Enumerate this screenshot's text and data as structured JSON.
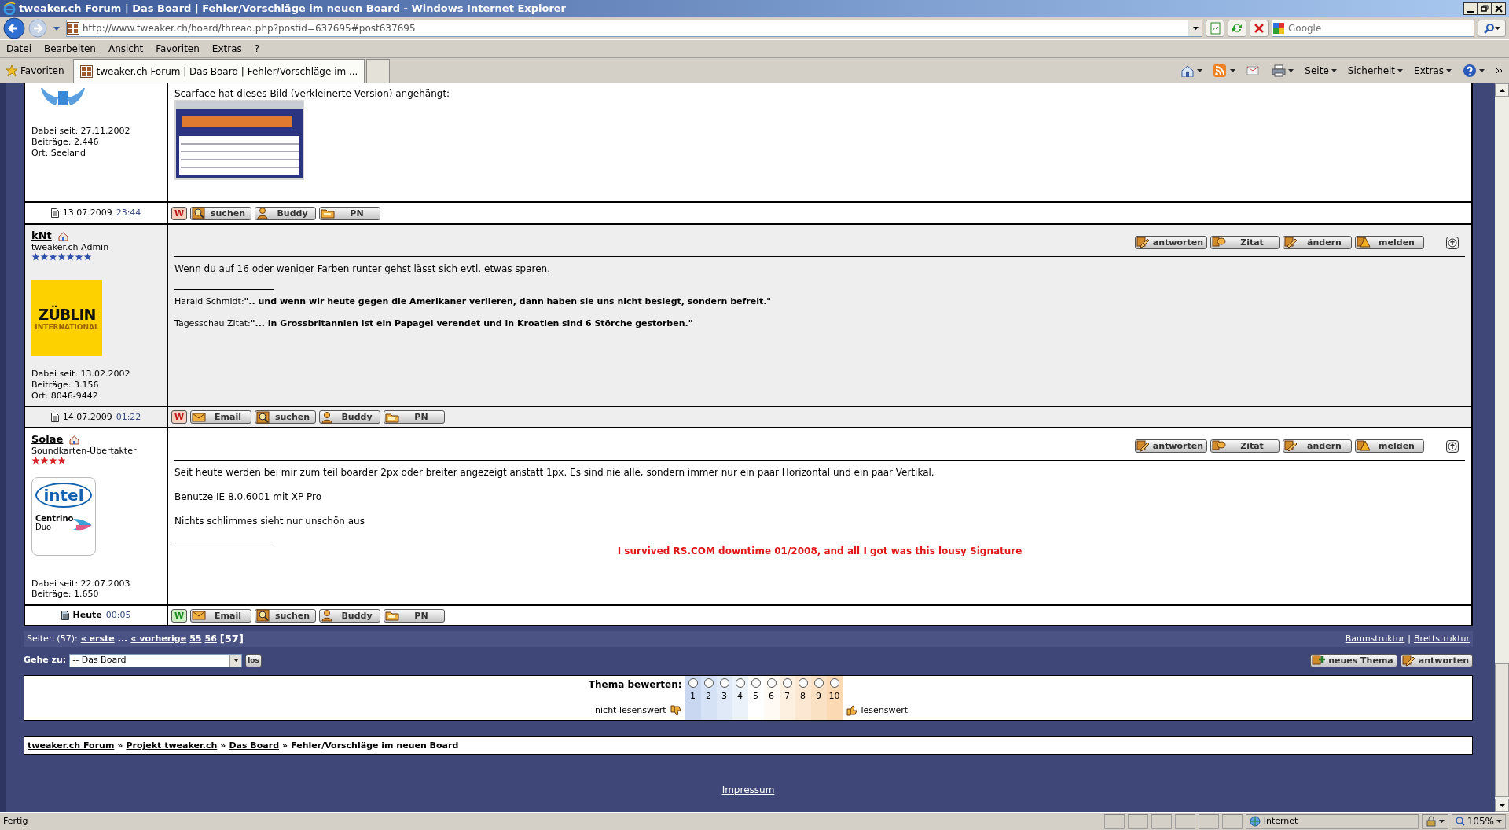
{
  "window": {
    "title": "tweaker.ch Forum | Das Board | Fehler/Vorschläge im neuen Board - Windows Internet Explorer"
  },
  "address_bar": {
    "url": "http://www.tweaker.ch/board/thread.php?postid=637695#post637695"
  },
  "search": {
    "placeholder": "Google"
  },
  "menu": [
    "Datei",
    "Bearbeiten",
    "Ansicht",
    "Favoriten",
    "Extras",
    "?"
  ],
  "favorites_bar": {
    "label": "Favoriten",
    "tabs": [
      {
        "label": "tweaker.ch Forum | Das Board | Fehler/Vorschläge im ...",
        "selected": true
      }
    ],
    "commands": [
      "Seite",
      "Sicherheit",
      "Extras"
    ]
  },
  "posts": [
    {
      "avatar": {
        "kind": "globe"
      },
      "stats": [
        "Dabei seit: 27.11.2002",
        "Beiträge: 2.446",
        "Ort: Seeland"
      ],
      "blocks": [
        {
          "kind": "attachment_caption",
          "text": "Scarface hat dieses Bild (verkleinerte Version) angehängt:"
        },
        {
          "kind": "image"
        }
      ],
      "footer": {
        "date": "13.07.2009",
        "time": "23:44",
        "today": false,
        "online": false,
        "buttons": [
          {
            "kind": "www",
            "label": "W"
          },
          {
            "kind": "search",
            "label": "suchen"
          },
          {
            "kind": "buddy",
            "label": "Buddy"
          },
          {
            "kind": "pm",
            "label": "PN"
          }
        ]
      }
    },
    {
      "username": "kNt",
      "rank": "tweaker.ch Admin",
      "stars": 7,
      "color": "#2b4fa8",
      "avatar": {
        "kind": "yellow_logo",
        "lines": [
          "ZÜBLIN",
          "INTERNATIONAL"
        ]
      },
      "stats": [
        "Dabei seit: 13.02.2002",
        "Beiträge: 3.156",
        "Ort: 8046-9442"
      ],
      "actions": [
        {
          "kind": "reply",
          "label": "antworten"
        },
        {
          "kind": "quote",
          "label": "Zitat"
        },
        {
          "kind": "edit",
          "label": "ändern"
        },
        {
          "kind": "report",
          "label": "melden"
        }
      ],
      "blocks": [
        {
          "kind": "paragraph",
          "text": "Wenn du auf 16 oder weniger Farben runter gehst lässt sich evtl. etwas sparen."
        },
        {
          "kind": "signature_rule"
        },
        {
          "kind": "signature_line",
          "text": "Harald Schmidt:**\".. und wenn wir heute gegen die Amerikaner verlieren, dann haben sie uns nicht besiegt, sondern befreit.\"**"
        },
        {
          "kind": "signature_line",
          "text": "Tagesschau Zitat:**\"... in Grossbritannien ist ein Papagei verendet und in Kroatien sind 6 Störche gestorben.\"**"
        }
      ],
      "footer": {
        "date": "14.07.2009",
        "time": "01:22",
        "today": false,
        "online": false,
        "buttons": [
          {
            "kind": "www",
            "label": "W"
          },
          {
            "kind": "email",
            "label": "Email"
          },
          {
            "kind": "search",
            "label": "suchen"
          },
          {
            "kind": "buddy",
            "label": "Buddy"
          },
          {
            "kind": "pm",
            "label": "PN"
          }
        ]
      }
    },
    {
      "username": "Solae",
      "rank": "Soundkarten-Übertakter",
      "stars": 4,
      "color": "#d42020",
      "avatar": {
        "kind": "chip_logo",
        "lines": [
          "intel",
          "Centrino",
          "Duo"
        ]
      },
      "stats": [
        "Dabei seit: 22.07.2003",
        "Beiträge: 1.650"
      ],
      "actions": [
        {
          "kind": "reply",
          "label": "antworten"
        },
        {
          "kind": "quote",
          "label": "Zitat"
        },
        {
          "kind": "edit",
          "label": "ändern"
        },
        {
          "kind": "report",
          "label": "melden"
        }
      ],
      "blocks": [
        {
          "kind": "paragraph",
          "text": "Seit heute werden bei mir zum teil boarder 2px oder breiter angezeigt anstatt 1px. Es sind nie alle, sondern immer nur ein paar Horizontal und ein paar Vertikal."
        },
        {
          "kind": "paragraph",
          "text": "Benutze IE 8.0.6001 mit XP Pro"
        },
        {
          "kind": "paragraph",
          "text": "Nichts schlimmes sieht nur unschön aus"
        },
        {
          "kind": "signature_rule"
        },
        {
          "kind": "signature_banner",
          "text": "I survived RS.COM downtime 01/2008, and all I got was this lousy Signature"
        }
      ],
      "footer": {
        "date": "Heute",
        "time": "00:05",
        "today": true,
        "online": true,
        "buttons": [
          {
            "kind": "www",
            "label": "W"
          },
          {
            "kind": "email",
            "label": "Email"
          },
          {
            "kind": "search",
            "label": "suchen"
          },
          {
            "kind": "buddy",
            "label": "Buddy"
          },
          {
            "kind": "pm",
            "label": "PN"
          }
        ]
      }
    }
  ],
  "pagination": {
    "label": "Seiten (57):",
    "items": [
      {
        "kind": "link",
        "label": "« erste"
      },
      {
        "kind": "text",
        "label": "..."
      },
      {
        "kind": "link",
        "label": "« vorherige"
      },
      {
        "kind": "link",
        "label": "55"
      },
      {
        "kind": "link",
        "label": "56"
      },
      {
        "kind": "current",
        "label": "[57]"
      }
    ],
    "views": [
      {
        "kind": "link",
        "label": "Baumstruktur"
      },
      {
        "kind": "separator",
        "label": "|"
      },
      {
        "kind": "link",
        "label": "Brettstruktur"
      }
    ]
  },
  "goto": {
    "label": "Gehe zu:",
    "value": "-- Das Board",
    "button": "los"
  },
  "thread_buttons": [
    {
      "kind": "new_thread",
      "label": "neues Thema"
    },
    {
      "kind": "reply",
      "label": "antworten"
    }
  ],
  "rating": {
    "title": "Thema bewerten:",
    "low_label": "nicht lesenswert",
    "high_label": "lesenswert",
    "options": [
      {
        "label": "1",
        "selected": false,
        "color": "#c9d8f0"
      },
      {
        "label": "2",
        "selected": false,
        "color": "#d5e1f4"
      },
      {
        "label": "3",
        "selected": false,
        "color": "#e0e9f7"
      },
      {
        "label": "4",
        "selected": false,
        "color": "#ecf2fa"
      },
      {
        "label": "5",
        "selected": false,
        "color": "#ffffff"
      },
      {
        "label": "6",
        "selected": false,
        "color": "#fffaf4"
      },
      {
        "label": "7",
        "selected": false,
        "color": "#fdf0e0"
      },
      {
        "label": "8",
        "selected": false,
        "color": "#fce8d2"
      },
      {
        "label": "9",
        "selected": false,
        "color": "#fbe1c4"
      },
      {
        "label": "10",
        "selected": false,
        "color": "#fad9b3"
      }
    ]
  },
  "breadcrumb": [
    {
      "kind": "link",
      "label": "tweaker.ch Forum"
    },
    {
      "kind": "separator",
      "label": "»"
    },
    {
      "kind": "link",
      "label": "Projekt tweaker.ch"
    },
    {
      "kind": "separator",
      "label": "»"
    },
    {
      "kind": "link",
      "label": "Das Board"
    },
    {
      "kind": "separator",
      "label": "»"
    },
    {
      "kind": "current",
      "label": "Fehler/Vorschläge im neuen Board"
    }
  ],
  "footer_link": "Impressum",
  "status_bar": {
    "text": "Fertig",
    "zone": "Internet",
    "zoom": "105%"
  }
}
